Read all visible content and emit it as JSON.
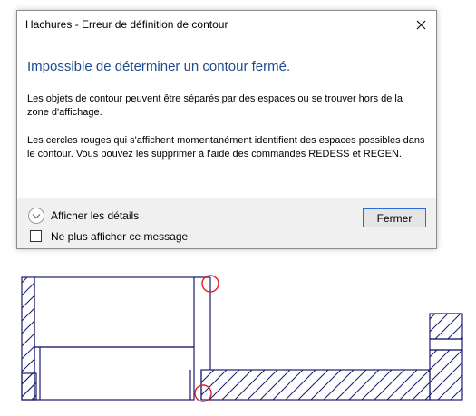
{
  "dialog": {
    "title": "Hachures - Erreur de définition de contour",
    "close_icon": "close-icon",
    "heading": "Impossible de déterminer un contour fermé.",
    "paragraph1": "Les objets de contour peuvent être séparés par des espaces ou se trouver hors de la zone d'affichage.",
    "paragraph2": "Les cercles rouges qui s'affichent momentanément identifient des espaces possibles dans le contour. Vous pouvez les supprimer à l'aide des commandes REDESS et REGEN.",
    "details_label": "Afficher les détails",
    "details_icon": "chevron-down-icon",
    "dont_show_label": "Ne plus afficher ce message",
    "dont_show_checked": false,
    "close_button": "Fermer"
  },
  "colors": {
    "heading": "#1e4b8f",
    "drawing_lines": "#1a1a6e",
    "gap_markers": "#e02020"
  }
}
